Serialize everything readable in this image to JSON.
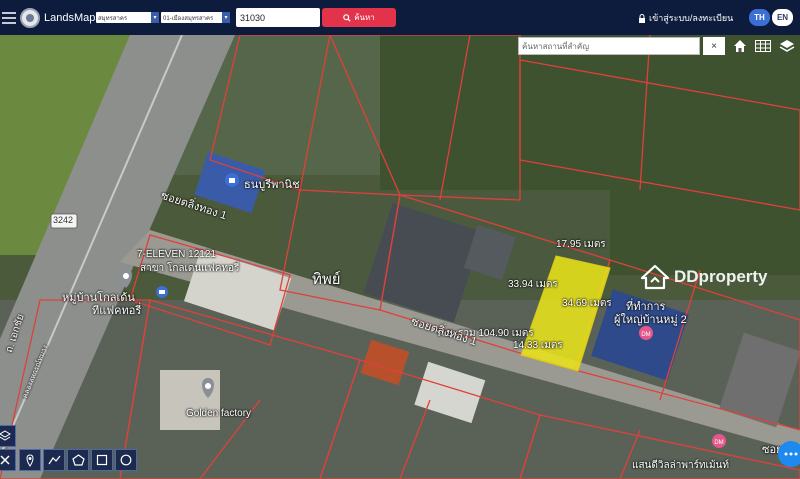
{
  "header": {
    "brand": "LandsMaps",
    "province_select": "สมุทรสาคร",
    "district_select": "01-เมืองสมุทรสาคร",
    "search_value": "31030",
    "search_button": "ค้นหา",
    "login_link": "เข้าสู่ระบบ/ลงทะเบียน",
    "lang_th": "TH",
    "lang_en": "EN"
  },
  "map_search": {
    "placeholder": "ค้นหาสถานที่สำคัญ",
    "clear": "×"
  },
  "labels": {
    "road_number": "3242",
    "soi_top": "ซอยตลิ่งทอง 1",
    "shop": "ธนบูรีพานิช",
    "seven": "7-ELEVEN 12121",
    "seven_sub": "สาขา โกลเดนแฟคทอรี่",
    "village": "หมู่บ้านโกลเด้น",
    "village_sub": "ทีแฟคทอรี่",
    "road_left": "ถ. เอกชัย",
    "road_left2": "คลองสหกรณ์ทมาง",
    "thip": "ทิพย์",
    "dim_top": "17.95 เมตร",
    "dim_left": "33.94 เมตร",
    "dim_right": "34.69 เมตร",
    "total": "ระยะรวม 104.90 เมตร",
    "dim_bottom": "14.33 เมตร",
    "soi_bottom": "ซอยตลิ่งทอง 1",
    "office": "ที่ทำการ",
    "office_sub": "ผู้ใหญ่บ้านหมู่ 2",
    "golden": "Golden factory",
    "soi_right": "ซอย",
    "sandee": "แสนดีวิลล่าพาร์ทเม้นท์",
    "watermark": "DDproperty"
  },
  "chat_icon": "chat-icon",
  "colors": {
    "topbar": "#0d1b3d",
    "parcel": "#e8e21a",
    "boundary": "#e0403a",
    "search_button": "#e3334a",
    "lang_active": "#3b6fd4"
  }
}
